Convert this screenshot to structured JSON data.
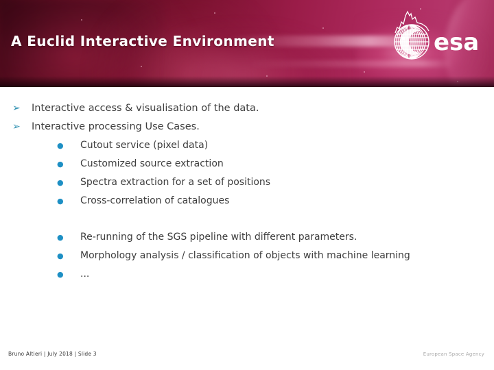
{
  "slide": {
    "title": "A Euclid Interactive Environment",
    "logo": {
      "wordmark": "esa",
      "alt": "European Space Agency logo"
    },
    "colors": {
      "banner_dark": "#3b0713",
      "banner_mid": "#77102c",
      "banner_bright": "#b4356a",
      "level1_marker": "#2d8fb0",
      "level2_marker": "#1d8fc4",
      "body_text": "#3d3d3d",
      "title_text": "#ffffff",
      "footer_right_text": "#a9a9a9"
    },
    "markers": {
      "level1_glyph": "➢",
      "level1_icon_name": "arrowhead-bullet-icon",
      "level2_glyph": "●",
      "level2_icon_name": "dot-bullet-icon"
    },
    "bullets": [
      {
        "level": 1,
        "text": "Interactive access & visualisation of the data."
      },
      {
        "level": 1,
        "text": "Interactive processing Use Cases."
      },
      {
        "level": 2,
        "text": "Cutout service (pixel data)"
      },
      {
        "level": 2,
        "text": "Customized source extraction"
      },
      {
        "level": 2,
        "text": "Spectra extraction for a set of positions"
      },
      {
        "level": 2,
        "text": "Cross-correlation of catalogues"
      },
      {
        "level": 2,
        "text": "Re-running of the SGS pipeline with different parameters."
      },
      {
        "level": 2,
        "text": "Morphology analysis / classification of objects with machine learning"
      },
      {
        "level": 2,
        "text": "..."
      }
    ],
    "footer": {
      "left": "Bruno Altieri | July 2018 | Slide  3",
      "right": "European Space Agency"
    }
  }
}
